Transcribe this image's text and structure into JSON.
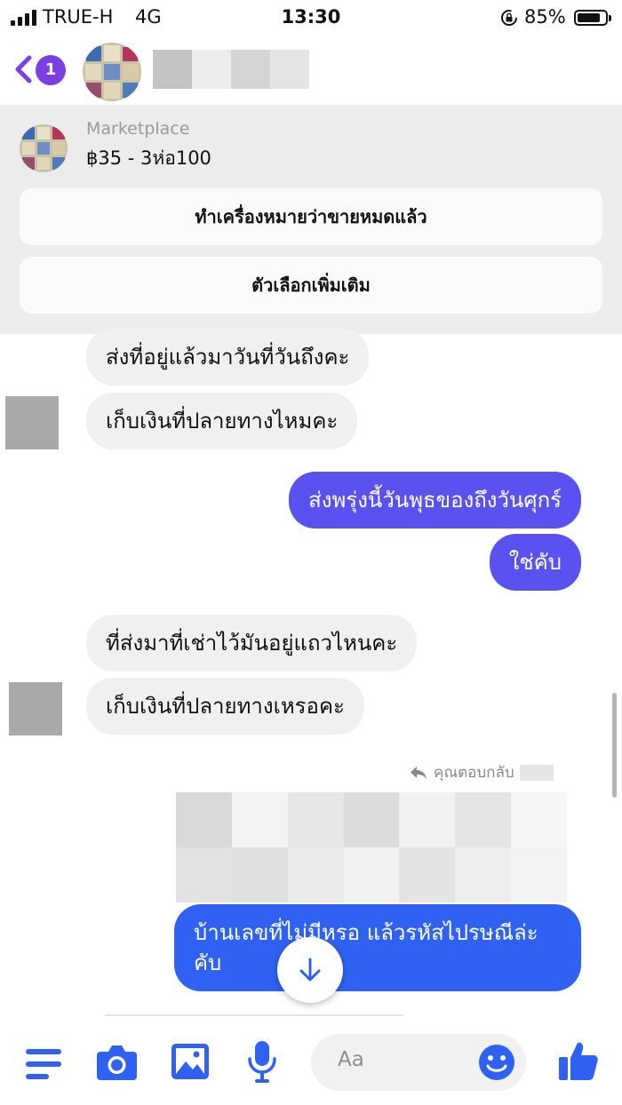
{
  "status_bar": {
    "carrier": "TRUE-H",
    "network": "4G",
    "time": "13:30",
    "battery_percent": "85%",
    "icons": [
      "signal-icon",
      "rotation-lock-icon",
      "battery-icon"
    ]
  },
  "header": {
    "back_badge_count": "1",
    "icons": [
      "chevron-left-icon",
      "avatar"
    ]
  },
  "marketplace": {
    "source": "Marketplace",
    "price": "฿35 - 3ห่อ100",
    "mark_sold_label": "ทำเครื่องหมายว่าขายหมดแล้ว",
    "more_options_label": "ตัวเลือกเพิ่มเติม"
  },
  "messages": [
    {
      "side": "incoming",
      "text": "ส่งที่อยู่แล้วมาวันที่วันถึงคะ"
    },
    {
      "side": "incoming",
      "text": "เก็บเงินที่ปลายทางไหมคะ"
    },
    {
      "side": "outgoing",
      "text": "ส่งพรุ่งนี้วันพุธของถึงวันศุกร์"
    },
    {
      "side": "outgoing",
      "text": "ใช่คับ"
    },
    {
      "side": "incoming",
      "text": "ที่ส่งมาที่เช่าไว้มันอยู่แถวไหนคะ"
    },
    {
      "side": "incoming",
      "text": "เก็บเงินที่ปลายทางเหรอคะ"
    },
    {
      "side": "outgoing",
      "text": "บ้านเลขที่ไม่มีหรอ แล้วรหัสไปรษณีล่ะคับ"
    }
  ],
  "reply_note": "คุณตอบกลับ",
  "composer": {
    "placeholder": "Aa",
    "icons": [
      "menu-icon",
      "camera-icon",
      "image-icon",
      "microphone-icon",
      "emoji-icon",
      "thumbs-up-icon"
    ]
  },
  "colors": {
    "accent": "#2f62f2",
    "bubble_out": "#5a52f0",
    "bubble_in": "#f0f0f0",
    "back": "#7b3fe4",
    "marketplace_bg": "#ececec"
  }
}
